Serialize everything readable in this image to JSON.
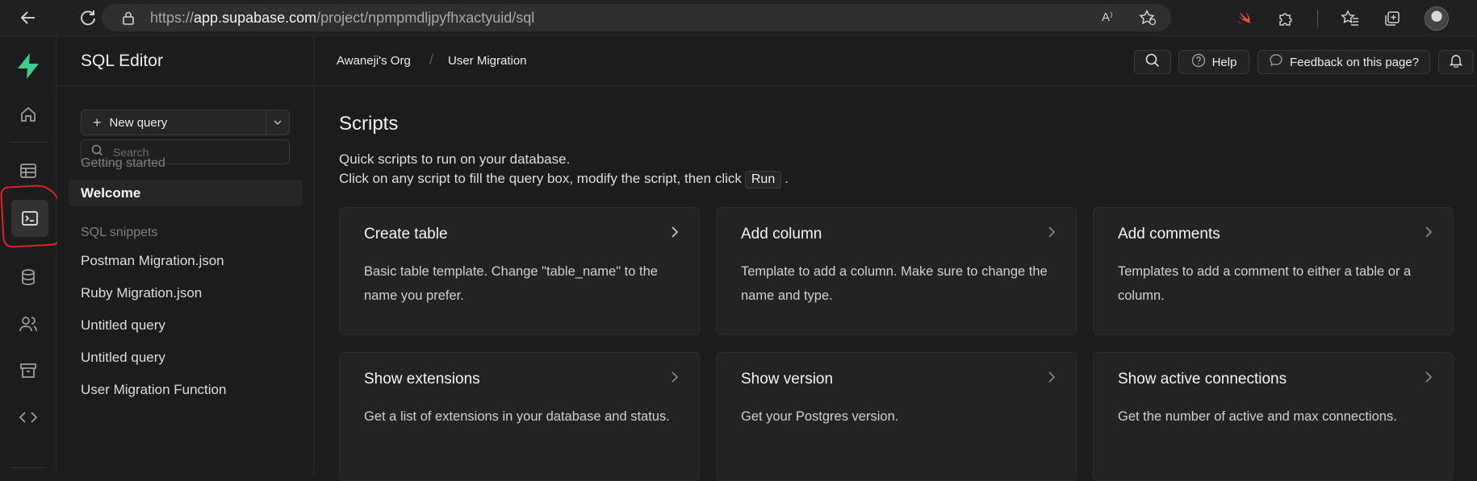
{
  "browser": {
    "url_scheme": "https://",
    "url_host": "app.supabase.com",
    "url_path": "/project/npmpmdljpyfhxactyuid/sql",
    "reader_label": "A⁾"
  },
  "panel": {
    "title": "SQL Editor",
    "new_query_label": "New query",
    "search_placeholder": "Search",
    "getting_started_label": "Getting started",
    "welcome_label": "Welcome",
    "snippets_label": "SQL snippets",
    "snippets": [
      "Postman Migration.json",
      "Ruby Migration.json",
      "Untitled query",
      "Untitled query",
      "User Migration Function"
    ]
  },
  "header": {
    "org": "Awaneji's Org",
    "project": "User Migration",
    "separator": "/",
    "help_label": "Help",
    "feedback_label": "Feedback on this page?"
  },
  "scripts": {
    "title": "Scripts",
    "line1": "Quick scripts to run on your database.",
    "line2_prefix": "Click on any script to fill the query box, modify the script, then click",
    "run_label": "Run",
    "line2_suffix": ".",
    "cards": [
      {
        "title": "Create table",
        "desc": "Basic table template. Change \"table_name\" to the name you prefer."
      },
      {
        "title": "Add column",
        "desc": "Template to add a column. Make sure to change the name and type."
      },
      {
        "title": "Add comments",
        "desc": "Templates to add a comment to either a table or a column."
      },
      {
        "title": "Show extensions",
        "desc": "Get a list of extensions in your database and status."
      },
      {
        "title": "Show version",
        "desc": "Get your Postgres version."
      },
      {
        "title": "Show active connections",
        "desc": "Get the number of active and max connections."
      }
    ]
  },
  "colors": {
    "brand": "#3ecf8e",
    "annotation": "#e0202a"
  }
}
